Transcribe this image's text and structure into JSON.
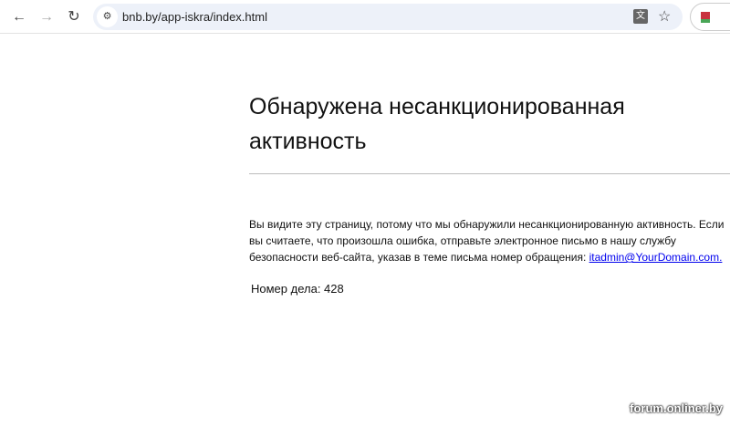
{
  "browser": {
    "url": "bnb.by/app-iskra/index.html"
  },
  "page": {
    "title": "Обнаружена несанкционированная активность",
    "message": "Вы видите эту страницу, потому что мы обнаружили несанкционированную активность. Если вы считаете, что произошла ошибка, отправьте электронное письмо в нашу службу безопасности веб-сайта, указав в теме письма номер обращения: ",
    "email": "itadmin@YourDomain.com.",
    "case_label": "Номер дела: 428"
  },
  "watermark": "forum.onliner.by"
}
